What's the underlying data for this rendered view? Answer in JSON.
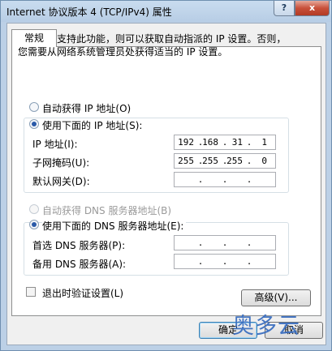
{
  "window": {
    "title": "Internet 协议版本 4 (TCP/IPv4) 属性",
    "help_glyph": "?",
    "close_glyph": "x"
  },
  "tabs": [
    {
      "label": "常规"
    }
  ],
  "description": {
    "line1": "如果网络支持此功能，则可以获取自动指派的 IP 设置。否则，",
    "line2": "您需要从网络系统管理员处获得适当的 IP 设置。"
  },
  "ip_settings": {
    "auto_label": "自动获得 IP 地址(O)",
    "manual_label": "使用下面的 IP 地址(S):",
    "selected": "manual",
    "fields": [
      {
        "label": "IP 地址(I):",
        "octets": [
          "192",
          "168",
          "31",
          "1"
        ]
      },
      {
        "label": "子网掩码(U):",
        "octets": [
          "255",
          "255",
          "255",
          "0"
        ]
      },
      {
        "label": "默认网关(D):",
        "octets": [
          "",
          "",
          "",
          ""
        ]
      }
    ]
  },
  "dns_settings": {
    "auto_label": "自动获得 DNS 服务器地址(B)",
    "manual_label": "使用下面的 DNS 服务器地址(E):",
    "selected": "manual",
    "fields": [
      {
        "label": "首选 DNS 服务器(P):",
        "octets": [
          "",
          "",
          "",
          ""
        ]
      },
      {
        "label": "备用 DNS 服务器(A):",
        "octets": [
          "",
          "",
          "",
          ""
        ]
      }
    ]
  },
  "validate_on_exit": {
    "label": "退出时验证设置(L)",
    "checked": false
  },
  "buttons": {
    "advanced": "高级(V)...",
    "ok": "确定",
    "cancel": "取消"
  },
  "watermark": "奥多云",
  "ip_dot": "."
}
